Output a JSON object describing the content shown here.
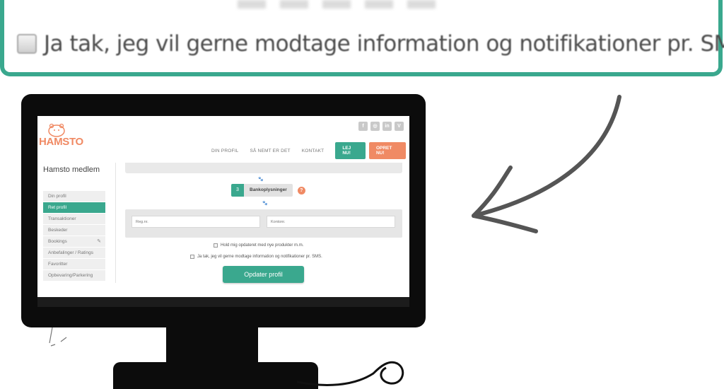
{
  "zoom": {
    "sms_consent_label": "Ja tak, jeg vil gerne modtage information og notifikationer pr. SMS."
  },
  "site": {
    "brand": "HAMSTO",
    "social_icons": [
      "f",
      "◎",
      "in",
      "V"
    ],
    "nav": {
      "links": [
        "DIN PROFIL",
        "SÅ NEMT ER DET",
        "KONTAKT"
      ],
      "rent_button": "LEJ NU!",
      "create_button": "OPRET NU!"
    }
  },
  "sidebar": {
    "title": "Hamsto medlem",
    "items": [
      {
        "label": "Din profil"
      },
      {
        "label": "Ret profil"
      },
      {
        "label": "Transaktioner"
      },
      {
        "label": "Beskeder"
      },
      {
        "label": "Bookings"
      },
      {
        "label": "Anbefalinger / Ratings"
      },
      {
        "label": "Favoritter"
      },
      {
        "label": "Opbevaring/Parkering"
      }
    ],
    "active_index": 1
  },
  "form": {
    "step_number": "3",
    "step_label": "Bankoplysninger",
    "help_icon": "?",
    "reg_placeholder": "Reg.nr.",
    "account_placeholder": "Kontonr.",
    "newsletter_label": "Hold mig opdateret med nye produkter m.m.",
    "sms_label": "Ja tak, jeg vil gerne modtage information og notifikationer pr. SMS.",
    "submit_label": "Opdater profil"
  },
  "colors": {
    "accent_green": "#3aa88e",
    "accent_orange": "#f08a64"
  }
}
